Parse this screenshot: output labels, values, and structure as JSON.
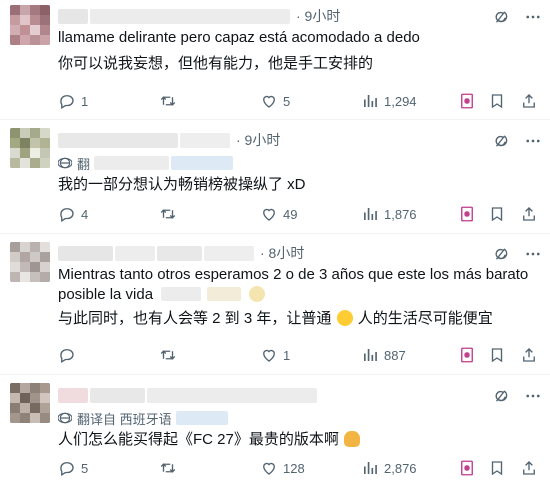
{
  "colors": {
    "text": "#0f1419",
    "secondary": "#536471",
    "divider": "#eff3f4",
    "grok_pink": "#c03a8a"
  },
  "icons": {
    "reply": "reply-icon",
    "retweet": "retweet-icon",
    "like": "like-icon",
    "views": "views-icon",
    "grok": "grok-icon",
    "bookmark": "bookmark-icon",
    "share": "share-icon",
    "more": "more-icon",
    "translate": "translate-icon"
  },
  "tweets": [
    {
      "time": "· 9小时",
      "lines": [
        "llamame delirante pero capaz está acomodado a dedo",
        "你可以说我妄想，但他有能力，他是手工安排的"
      ],
      "replies": "1",
      "retweets": "",
      "likes": "5",
      "views": "1,294"
    },
    {
      "time": "· 9小时",
      "translate_label": "翻",
      "lines": [
        "我的一部分想认为畅销榜被操纵了 xD"
      ],
      "replies": "4",
      "retweets": "",
      "likes": "49",
      "views": "1,876"
    },
    {
      "time": "· 8小时",
      "lines": [
        "Mientras tanto otros esperamos 2 o de 3 años que este los más barato",
        "posible la vida",
        "与此同时，也有人会等 2 到 3 年，让普通",
        "人的生活尽可能便宜"
      ],
      "replies": "",
      "retweets": "",
      "likes": "1",
      "views": "887"
    },
    {
      "time": "",
      "translate_label": "翻译自 西班牙语",
      "lines": [
        "人们怎么能买得起《FC 27》最贵的版本啊"
      ],
      "replies": "5",
      "retweets": "",
      "likes": "128",
      "views": "2,876"
    }
  ]
}
